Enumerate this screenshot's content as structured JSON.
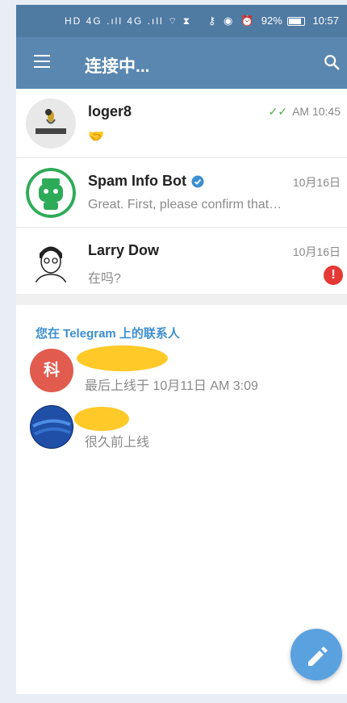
{
  "status_bar": {
    "left_icons": "HD 4G .ıll 4G .ıll ⌔ ⧗",
    "battery": "92%",
    "time": "10:57"
  },
  "header": {
    "title": "连接中..."
  },
  "chats": [
    {
      "name": "loger8",
      "time": "AM 10:45",
      "preview": "🤝",
      "read": true
    },
    {
      "name": "Spam Info Bot",
      "time": "10月16日",
      "preview": "Great. First, please confirm that…",
      "verified": true
    },
    {
      "name": "Larry Dow",
      "time": "10月16日",
      "preview": "在吗?",
      "alert": "!"
    }
  ],
  "contacts_section": {
    "title": "您在 Telegram 上的联系人",
    "contacts": [
      {
        "initial": "科",
        "status": "最后上线于 10月11日 AM 3:09",
        "color": "#e25b4f"
      },
      {
        "initial": "",
        "status": "很久前上线",
        "color": "#2c63b0"
      }
    ]
  },
  "colors": {
    "appbar": "#5a87b0",
    "status_bar": "#4f7aa2",
    "accent": "#3d8fd1",
    "fab": "#5aa1e0"
  },
  "icons": [
    "menu-icon",
    "search-icon",
    "double-check-icon",
    "verified-icon",
    "alert-icon",
    "pencil-icon"
  ]
}
